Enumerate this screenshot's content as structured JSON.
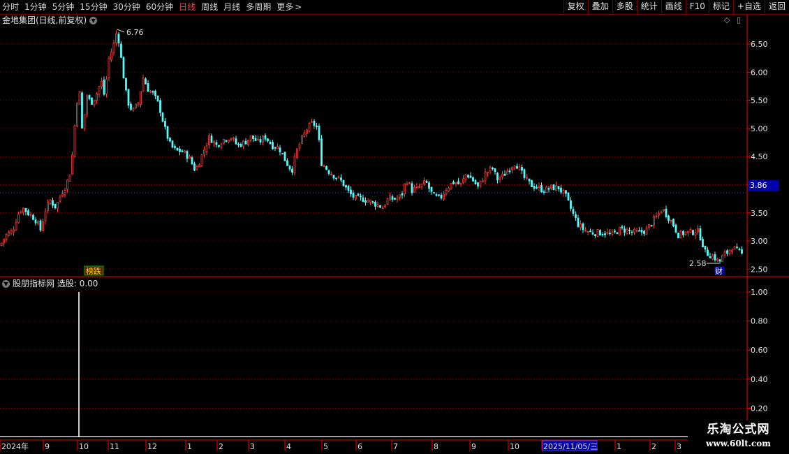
{
  "toolbar": {
    "periods": [
      "分时",
      "1分钟",
      "5分钟",
      "15分钟",
      "30分钟",
      "60分钟",
      "日线",
      "周线",
      "月线",
      "多周期",
      "更多"
    ],
    "active": "日线",
    "more_arrow": ">",
    "buttons": [
      "复权",
      "叠加",
      "多股",
      "统计",
      "画线",
      "F10",
      "标记",
      "+自选",
      "返回"
    ]
  },
  "chart": {
    "title": "金地集团(日线,前复权)",
    "current_price": "3.86",
    "high_label": "6.76",
    "low_label": "2.58",
    "badge_rank": "榜跌",
    "badge_fin": "财"
  },
  "indicator": {
    "name": "股朋指标网",
    "label": "选股: 0.00"
  },
  "x_axis": {
    "labels": [
      "2024年",
      "9",
      "10",
      "11",
      "12",
      "1",
      "2",
      "3",
      "4",
      "5",
      "6",
      "7",
      "8",
      "9",
      "10",
      "2025/11/05/三",
      "1",
      "2",
      "3"
    ]
  },
  "watermark": {
    "line1": "乐淘公式网",
    "line2": "www.60lt.com"
  },
  "colors": {
    "up": "#ff3c3c",
    "down": "#54fcfc",
    "grid": "#8a0000",
    "axis": "#ff0000"
  },
  "chart_data": [
    {
      "type": "candlestick",
      "title": "金地集团(日线,前复权)",
      "y_ticks": [
        2.5,
        3.0,
        3.5,
        4.0,
        4.5,
        5.0,
        5.5,
        6.0,
        6.5
      ],
      "ylim": [
        2.4,
        6.85
      ],
      "x_ticks": [
        "2024年",
        "9",
        "10",
        "11",
        "12",
        "1",
        "2",
        "3",
        "4",
        "5",
        "6",
        "7",
        "8",
        "9",
        "10",
        "2025/11/05/三",
        "1",
        "2",
        "3"
      ],
      "high": 6.76,
      "low": 2.58,
      "last": 3.86,
      "close_path": [
        [
          0,
          2.92
        ],
        [
          8,
          3.1
        ],
        [
          18,
          3.18
        ],
        [
          25,
          3.45
        ],
        [
          32,
          3.6
        ],
        [
          40,
          3.5
        ],
        [
          50,
          3.4
        ],
        [
          58,
          3.2
        ],
        [
          65,
          3.55
        ],
        [
          72,
          3.72
        ],
        [
          80,
          3.6
        ],
        [
          88,
          3.85
        ],
        [
          95,
          4.0
        ],
        [
          102,
          4.3
        ],
        [
          108,
          5.2
        ],
        [
          113,
          5.8
        ],
        [
          118,
          4.9
        ],
        [
          124,
          5.6
        ],
        [
          130,
          5.45
        ],
        [
          138,
          5.6
        ],
        [
          145,
          5.85
        ],
        [
          150,
          5.55
        ],
        [
          155,
          6.2
        ],
        [
          162,
          6.45
        ],
        [
          168,
          6.76
        ],
        [
          175,
          6.1
        ],
        [
          182,
          5.5
        ],
        [
          190,
          5.3
        ],
        [
          198,
          5.45
        ],
        [
          205,
          5.9
        ],
        [
          212,
          5.7
        ],
        [
          220,
          5.6
        ],
        [
          228,
          5.4
        ],
        [
          236,
          5.0
        ],
        [
          244,
          4.7
        ],
        [
          252,
          4.6
        ],
        [
          260,
          4.6
        ],
        [
          270,
          4.5
        ],
        [
          280,
          4.25
        ],
        [
          290,
          4.55
        ],
        [
          300,
          4.85
        ],
        [
          310,
          4.7
        ],
        [
          320,
          4.8
        ],
        [
          330,
          4.85
        ],
        [
          340,
          4.7
        ],
        [
          350,
          4.75
        ],
        [
          360,
          4.85
        ],
        [
          370,
          4.75
        ],
        [
          380,
          4.85
        ],
        [
          390,
          4.7
        ],
        [
          400,
          4.65
        ],
        [
          410,
          4.4
        ],
        [
          418,
          4.25
        ],
        [
          425,
          4.6
        ],
        [
          432,
          4.8
        ],
        [
          440,
          5.0
        ],
        [
          448,
          5.1
        ],
        [
          455,
          5.0
        ],
        [
          460,
          4.4
        ],
        [
          470,
          4.25
        ],
        [
          480,
          4.15
        ],
        [
          490,
          4.05
        ],
        [
          500,
          3.85
        ],
        [
          510,
          3.75
        ],
        [
          520,
          3.75
        ],
        [
          530,
          3.7
        ],
        [
          540,
          3.65
        ],
        [
          548,
          3.6
        ],
        [
          556,
          3.75
        ],
        [
          566,
          3.75
        ],
        [
          575,
          3.8
        ],
        [
          582,
          4.1
        ],
        [
          590,
          3.9
        ],
        [
          600,
          3.95
        ],
        [
          610,
          4.05
        ],
        [
          620,
          3.8
        ],
        [
          630,
          3.75
        ],
        [
          640,
          3.95
        ],
        [
          650,
          4.05
        ],
        [
          660,
          4.0
        ],
        [
          668,
          4.2
        ],
        [
          676,
          4.1
        ],
        [
          685,
          3.95
        ],
        [
          695,
          4.2
        ],
        [
          705,
          4.3
        ],
        [
          712,
          4.1
        ],
        [
          720,
          4.15
        ],
        [
          730,
          4.3
        ],
        [
          738,
          4.4
        ],
        [
          745,
          4.25
        ],
        [
          752,
          4.1
        ],
        [
          760,
          4.0
        ],
        [
          770,
          3.95
        ],
        [
          780,
          3.9
        ],
        [
          790,
          3.95
        ],
        [
          800,
          3.95
        ],
        [
          810,
          3.8
        ],
        [
          820,
          3.5
        ],
        [
          828,
          3.3
        ],
        [
          836,
          3.2
        ],
        [
          846,
          3.15
        ],
        [
          856,
          3.15
        ],
        [
          866,
          3.15
        ],
        [
          876,
          3.1
        ],
        [
          886,
          3.2
        ],
        [
          896,
          3.2
        ],
        [
          906,
          3.15
        ],
        [
          916,
          3.15
        ],
        [
          926,
          3.2
        ],
        [
          935,
          3.35
        ],
        [
          942,
          3.45
        ],
        [
          948,
          3.58
        ],
        [
          956,
          3.45
        ],
        [
          964,
          3.3
        ],
        [
          972,
          3.1
        ],
        [
          980,
          3.15
        ],
        [
          990,
          3.15
        ],
        [
          998,
          3.2
        ],
        [
          1004,
          3.05
        ],
        [
          1010,
          2.8
        ],
        [
          1018,
          2.75
        ],
        [
          1024,
          2.7
        ],
        [
          1030,
          2.62
        ],
        [
          1036,
          2.75
        ],
        [
          1042,
          2.8
        ],
        [
          1048,
          2.9
        ],
        [
          1056,
          2.82
        ],
        [
          1064,
          2.75
        ]
      ]
    },
    {
      "type": "bar",
      "title": "股朋指标网",
      "y_ticks": [
        0.2,
        0.4,
        0.6,
        0.8,
        1.0
      ],
      "ylim": [
        -0.05,
        1.05
      ],
      "signals": [
        {
          "x_index": 113,
          "value": 1.0
        }
      ],
      "baseline_value": 0.0
    }
  ]
}
